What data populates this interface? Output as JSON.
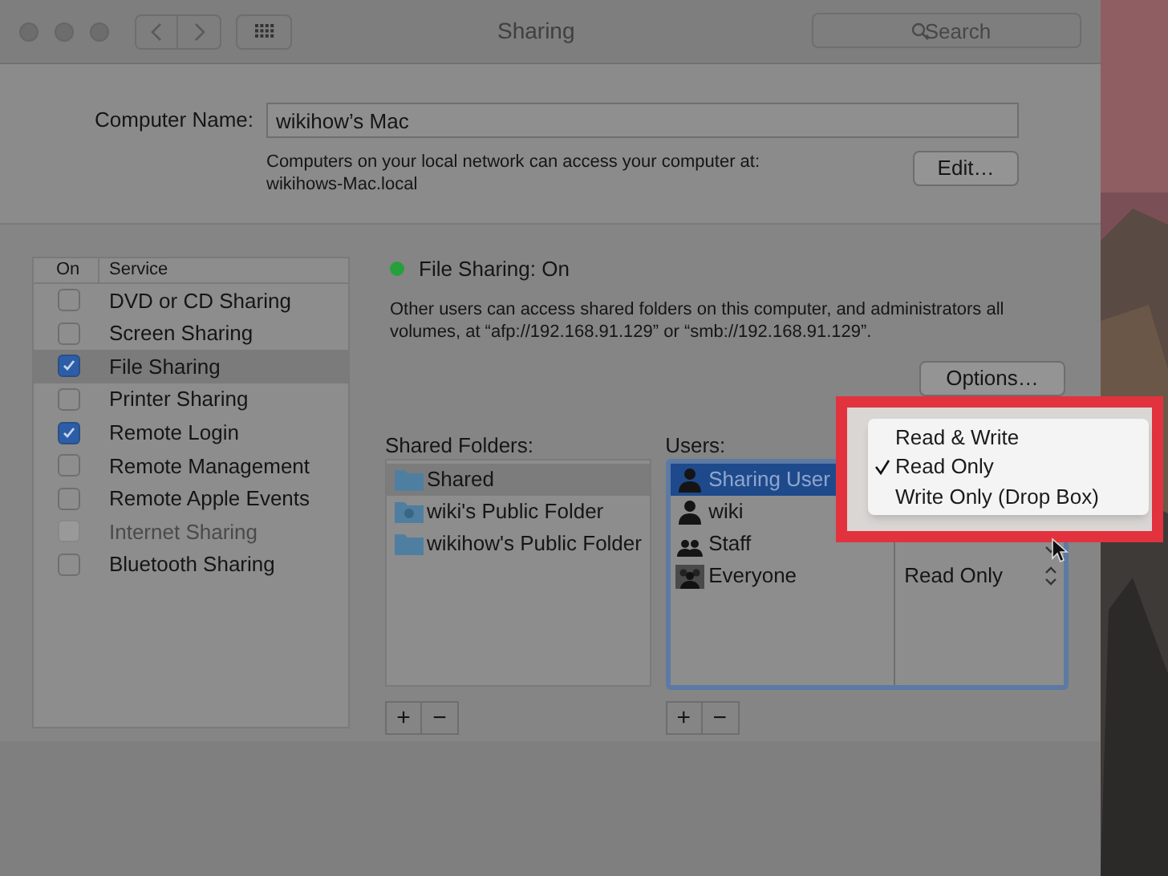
{
  "window": {
    "title": "Sharing",
    "search": {
      "placeholder": "Search"
    }
  },
  "computer_name": {
    "label": "Computer Name:",
    "value": "wikihow’s Mac",
    "note": "Computers on your local network can access your computer at:",
    "address": "wikihows-Mac.local",
    "button": "Edit…"
  },
  "services": {
    "columns": [
      "On",
      "Service"
    ],
    "items": [
      {
        "name": "DVD or CD Sharing",
        "checked": false,
        "selected": false,
        "disabled": false
      },
      {
        "name": "Screen Sharing",
        "checked": false,
        "selected": false,
        "disabled": false
      },
      {
        "name": "File Sharing",
        "checked": true,
        "selected": true,
        "disabled": false
      },
      {
        "name": "Printer Sharing",
        "checked": false,
        "selected": false,
        "disabled": false
      },
      {
        "name": "Remote Login",
        "checked": true,
        "selected": false,
        "disabled": false
      },
      {
        "name": "Remote Management",
        "checked": false,
        "selected": false,
        "disabled": false
      },
      {
        "name": "Remote Apple Events",
        "checked": false,
        "selected": false,
        "disabled": false
      },
      {
        "name": "Internet Sharing",
        "checked": false,
        "selected": false,
        "disabled": true
      },
      {
        "name": "Bluetooth Sharing",
        "checked": false,
        "selected": false,
        "disabled": false
      }
    ]
  },
  "file_sharing": {
    "status": "File Sharing: On",
    "on": true,
    "description": "Other users can access shared folders on this computer, and administrators all volumes, at “afp://192.168.91.129” or “smb://192.168.91.129”.",
    "options_button": "Options…"
  },
  "shared_folders": {
    "label": "Shared Folders:",
    "items": [
      {
        "name": "Shared",
        "kind": "folder",
        "selected": true
      },
      {
        "name": "wiki's Public Folder",
        "kind": "public-folder",
        "selected": false
      },
      {
        "name": "wikihow's Public Folder",
        "kind": "folder",
        "selected": false
      }
    ],
    "add": "+",
    "remove": "−"
  },
  "users": {
    "label": "Users:",
    "items": [
      {
        "name": "Sharing User",
        "kind": "user",
        "selected": true
      },
      {
        "name": "wiki",
        "kind": "user",
        "selected": false
      },
      {
        "name": "Staff",
        "kind": "group",
        "selected": false
      },
      {
        "name": "Everyone",
        "kind": "everyone",
        "selected": false,
        "permission": "Read Only"
      }
    ],
    "add": "+",
    "remove": "−"
  },
  "permission_menu": {
    "options": [
      {
        "label": "Read & Write",
        "selected": false
      },
      {
        "label": "Read Only",
        "selected": true
      },
      {
        "label": "Write Only (Drop Box)",
        "selected": false
      }
    ]
  }
}
